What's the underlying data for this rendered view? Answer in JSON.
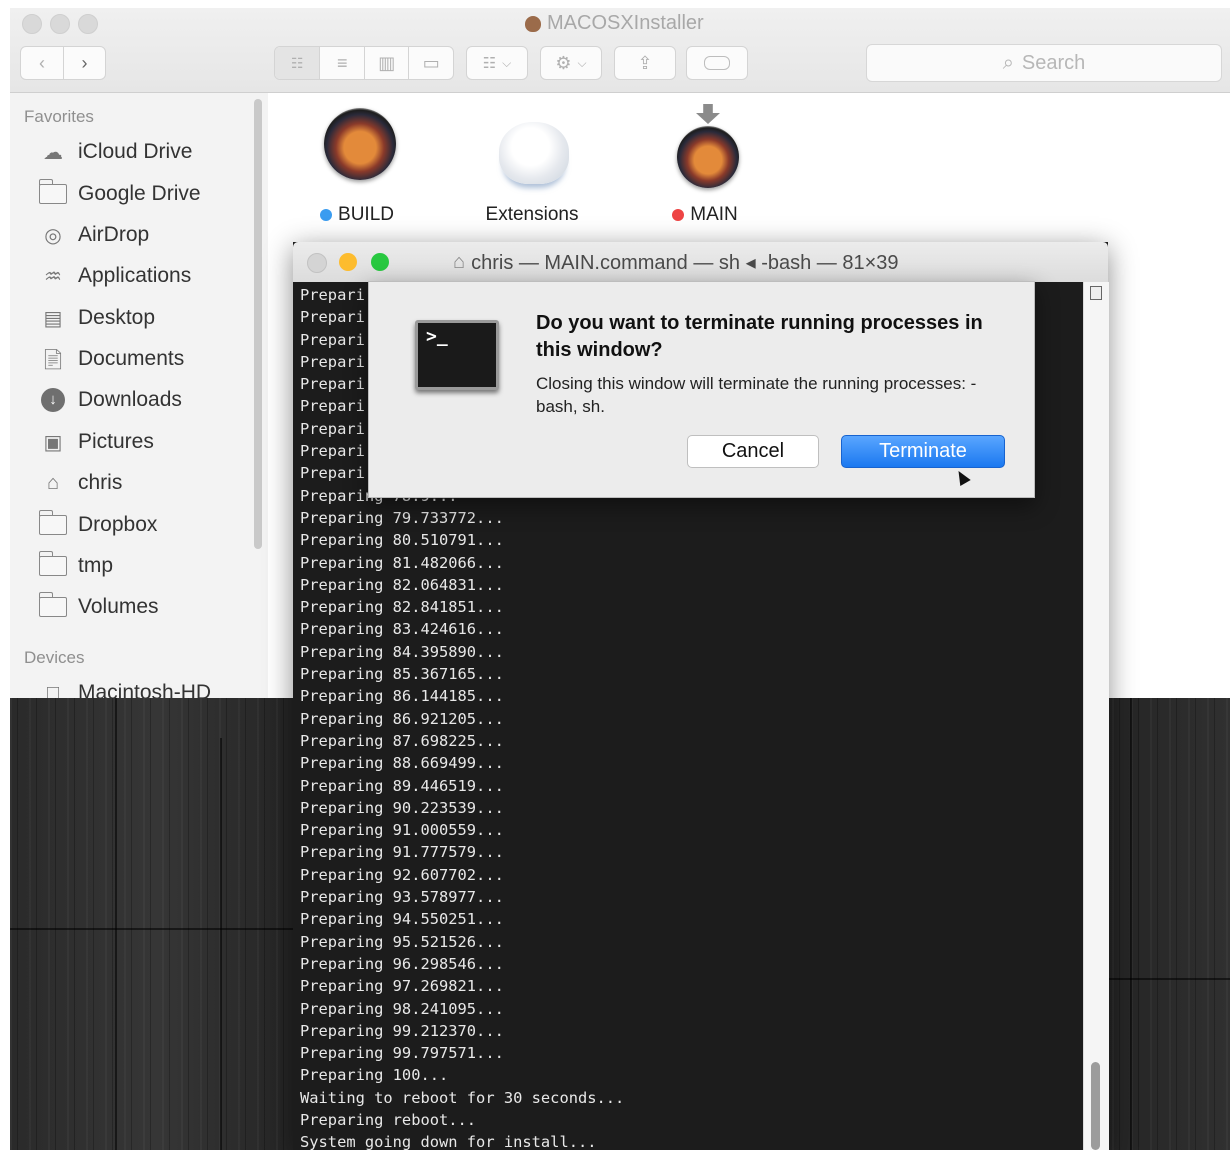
{
  "finder": {
    "title": "MACOSXInstaller",
    "search_placeholder": "Search",
    "sidebar": {
      "favorites_heading": "Favorites",
      "devices_heading": "Devices",
      "items": [
        {
          "label": "iCloud Drive",
          "icon": "cloud-icon"
        },
        {
          "label": "Google Drive",
          "icon": "folder-icon"
        },
        {
          "label": "AirDrop",
          "icon": "airdrop-icon"
        },
        {
          "label": "Applications",
          "icon": "applications-icon"
        },
        {
          "label": "Desktop",
          "icon": "desktop-icon"
        },
        {
          "label": "Documents",
          "icon": "documents-icon"
        },
        {
          "label": "Downloads",
          "icon": "downloads-icon"
        },
        {
          "label": "Pictures",
          "icon": "pictures-icon"
        },
        {
          "label": "chris",
          "icon": "home-icon"
        },
        {
          "label": "Dropbox",
          "icon": "folder-icon"
        },
        {
          "label": "tmp",
          "icon": "folder-icon"
        },
        {
          "label": "Volumes",
          "icon": "folder-icon"
        }
      ],
      "devices": [
        {
          "label": "Macintosh-HD",
          "icon": "hard-drive-icon"
        }
      ]
    },
    "files": [
      {
        "label": "BUILD",
        "tag_color": "#3a9cf0",
        "icon": "disk-image-icon"
      },
      {
        "label": "Extensions",
        "tag_color": "",
        "icon": "extensions-icon"
      },
      {
        "label": "MAIN",
        "tag_color": "#ee4444",
        "icon": "installer-disk-icon"
      }
    ]
  },
  "terminal": {
    "title": "chris — MAIN.command — sh ◂ -bash — 81×39",
    "lines": [
      "Prepari",
      "Prepari",
      "Prepari",
      "Prepari",
      "Prepari",
      "Prepari",
      "Prepari",
      "Prepari",
      "Prepari",
      "Preparing 78.9...",
      "Preparing 79.733772...",
      "Preparing 80.510791...",
      "Preparing 81.482066...",
      "Preparing 82.064831...",
      "Preparing 82.841851...",
      "Preparing 83.424616...",
      "Preparing 84.395890...",
      "Preparing 85.367165...",
      "Preparing 86.144185...",
      "Preparing 86.921205...",
      "Preparing 87.698225...",
      "Preparing 88.669499...",
      "Preparing 89.446519...",
      "Preparing 90.223539...",
      "Preparing 91.000559...",
      "Preparing 91.777579...",
      "Preparing 92.607702...",
      "Preparing 93.578977...",
      "Preparing 94.550251...",
      "Preparing 95.521526...",
      "Preparing 96.298546...",
      "Preparing 97.269821...",
      "Preparing 98.241095...",
      "Preparing 99.212370...",
      "Preparing 99.797571...",
      "Preparing 100...",
      "Waiting to reboot for 30 seconds...",
      "Preparing reboot...",
      "System going down for install..."
    ]
  },
  "alert": {
    "title": "Do you want to terminate running processes in this window?",
    "message": "Closing this window will terminate the running processes: -bash, sh.",
    "cancel_label": "Cancel",
    "terminate_label": "Terminate",
    "icon": "terminal-app-icon"
  },
  "colors": {
    "accent_blue": "#1a78f0",
    "close_red": "#fc5f57",
    "minimize_yellow": "#fdbc2e",
    "zoom_green": "#28c840"
  }
}
